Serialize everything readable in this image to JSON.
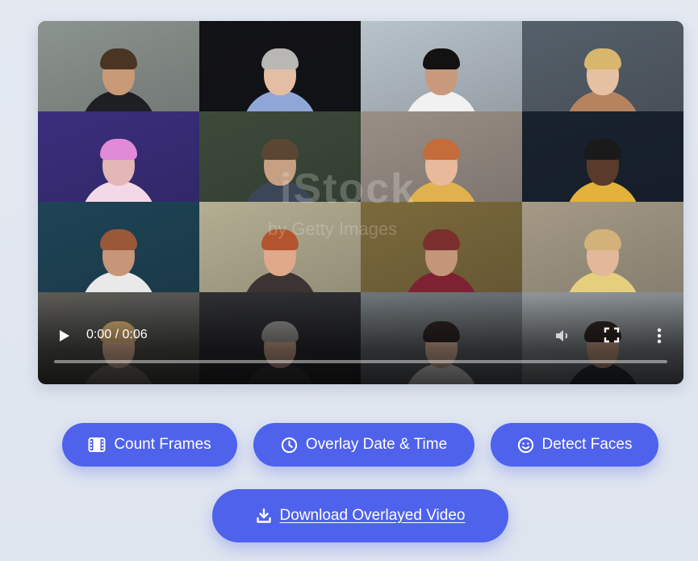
{
  "video": {
    "time_display": "0:00 / 0:06",
    "progress": 0.0,
    "watermark_main": "iStock",
    "watermark_sub": "by Getty Images",
    "tiles": [
      {
        "bg": "#8c948f",
        "skin": "#c89a78",
        "hair": "#4a3424",
        "shirt": "#1e1f22"
      },
      {
        "bg": "#121316",
        "skin": "#e4bea2",
        "hair": "#b9b7b4",
        "shirt": "#8fa6d6"
      },
      {
        "bg": "#b9c3cb",
        "skin": "#c79a7c",
        "hair": "#121212",
        "shirt": "#f1f1f1"
      },
      {
        "bg": "#56606a",
        "skin": "#e5c0a1",
        "hair": "#d8b66e",
        "shirt": "#b5845e"
      },
      {
        "bg": "#3b2e7d",
        "skin": "#e2b7b6",
        "hair": "#e08ad8",
        "shirt": "#f3d9e8"
      },
      {
        "bg": "#3d4a3a",
        "skin": "#c7a084",
        "hair": "#5b4634",
        "shirt": "#3b4656"
      },
      {
        "bg": "#9a8f86",
        "skin": "#e8b99a",
        "hair": "#c46c3a",
        "shirt": "#e0b14e"
      },
      {
        "bg": "#18222e",
        "skin": "#5a3a2b",
        "hair": "#1a1a1a",
        "shirt": "#e3b23a"
      },
      {
        "bg": "#1e4456",
        "skin": "#c79679",
        "hair": "#9a5838",
        "shirt": "#e9e9e9"
      },
      {
        "bg": "#b4ae92",
        "skin": "#dfa98a",
        "hair": "#b2552e",
        "shirt": "#3b3432"
      },
      {
        "bg": "#7c6a3c",
        "skin": "#c39579",
        "hair": "#7a2f2d",
        "shirt": "#7e2231"
      },
      {
        "bg": "#a59a86",
        "skin": "#e2b79a",
        "hair": "#d3b279",
        "shirt": "#e6cf7c"
      },
      {
        "bg": "#5b5a55",
        "skin": "#e0b497",
        "hair": "#d4ac70",
        "shirt": "#7f7a72"
      },
      {
        "bg": "#2e2f33",
        "skin": "#caa28c",
        "hair": "#8f8d8a",
        "shirt": "#3a3b3f"
      },
      {
        "bg": "#6e7478",
        "skin": "#ddb29a",
        "hair": "#2b2422",
        "shirt": "#e6e6e6"
      },
      {
        "bg": "#8e9497",
        "skin": "#c59a80",
        "hair": "#2b2320",
        "shirt": "#2f3440"
      }
    ]
  },
  "actions": {
    "count_frames": "Count Frames",
    "overlay_datetime": "Overlay Date & Time",
    "detect_faces": "Detect Faces",
    "download": "Download Overlayed Video"
  },
  "colors": {
    "button": "#4f62ec",
    "background": "#e1e6f0"
  }
}
